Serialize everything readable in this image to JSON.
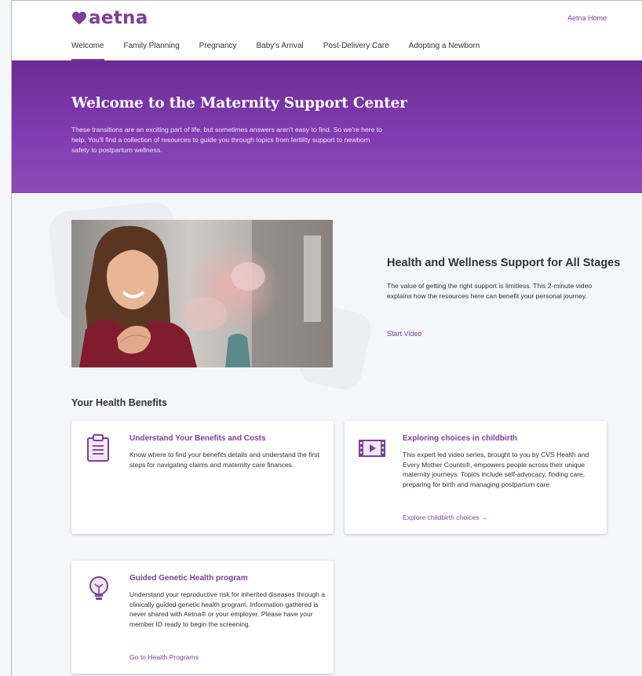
{
  "header": {
    "logo_text": "aetna",
    "home_link": "Aetna Home",
    "nav": [
      "Welcome",
      "Family Planning",
      "Pregnancy",
      "Baby's Arrival",
      "Post-Delivery Care",
      "Adopting a Newborn"
    ],
    "active_tab": "Welcome"
  },
  "hero": {
    "title": "Welcome to the Maternity Support Center",
    "text": "These transitions are an exciting part of life, but sometimes answers aren't easy to find. So we're here to help. You'll find a collection of resources to guide you through topics from fertility support to newborn safety to postpartum wellness."
  },
  "feature": {
    "title": "Health and Wellness Support for All Stages",
    "text": "The value of getting the right support is limitless. This 2-minute video explains how the resources here can benefit your personal journey.",
    "link": "Start Video"
  },
  "benefits": {
    "title": "Your Health Benefits",
    "cards": [
      {
        "icon": "clipboard-icon",
        "title": "Understand Your Benefits and Costs",
        "text": "Know where to find your benefits details and understand the first steps for navigating claims and maternity care finances.",
        "link": ""
      },
      {
        "icon": "video-film-icon",
        "title": "Exploring choices in childbirth",
        "text": "This expert led video series, brought to you by CVS Health and Every Mother Counts®, empowers people across their unique maternity journeys. Topics include self-advocacy, finding care, preparing for birth and managing postpartum care.",
        "link": "Explore childbirth choices →"
      },
      {
        "icon": "lightbulb-icon",
        "title": "Guided Genetic Health program",
        "text": "Understand your reproductive risk for inherited diseases through a clinically guided genetic health program. Information gathered is never shared with Aetna® or your employer. Please have your member ID ready to begin the screening.",
        "link": "Go to Health Programs"
      }
    ]
  },
  "colors": {
    "brand_purple": "#7d3f98",
    "hero_purple": "#7a35a8",
    "page_background": "#f5f6fa"
  }
}
